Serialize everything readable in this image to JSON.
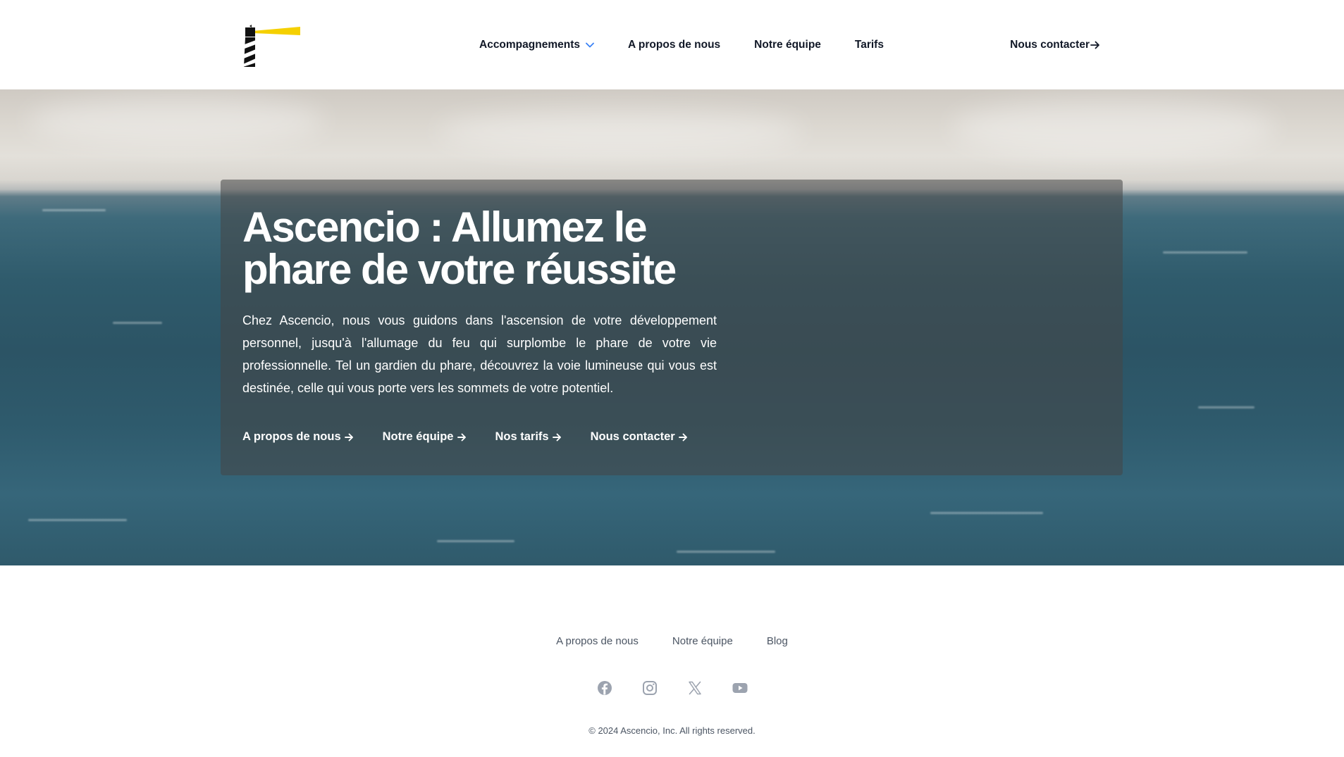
{
  "header": {
    "logo_icon": "lighthouse-logo-icon",
    "nav": [
      {
        "label": "Accompagnements",
        "has_dropdown": true
      },
      {
        "label": "A propos de nous"
      },
      {
        "label": "Notre équipe"
      },
      {
        "label": "Tarifs"
      }
    ],
    "contact_label": "Nous contacter"
  },
  "hero": {
    "title": "Ascencio : Allumez le phare de votre réussite",
    "text": "Chez Ascencio, nous vous guidons dans l'ascension de votre développement personnel, jusqu'à l'allumage du feu qui surplombe le phare de votre vie professionnelle. Tel un gardien du phare, découvrez la voie lumineuse qui vous est destinée, celle qui vous porte vers les sommets de votre potentiel.",
    "links": [
      {
        "label": "A propos de nous"
      },
      {
        "label": "Notre équipe"
      },
      {
        "label": "Nos tarifs"
      },
      {
        "label": "Nous contacter"
      }
    ]
  },
  "footer": {
    "nav": [
      {
        "label": "A propos de nous"
      },
      {
        "label": "Notre équipe"
      },
      {
        "label": "Blog"
      }
    ],
    "socials": [
      "facebook-icon",
      "instagram-icon",
      "x-icon",
      "youtube-icon"
    ],
    "copyright": "© 2024 Ascencio, Inc. All rights reserved."
  },
  "colors": {
    "accent_yellow": "#F5D000",
    "chevron_blue": "#3B82F6",
    "text_dark": "#111827",
    "text_muted": "#4B5563",
    "icon_gray": "#9CA3AF"
  }
}
